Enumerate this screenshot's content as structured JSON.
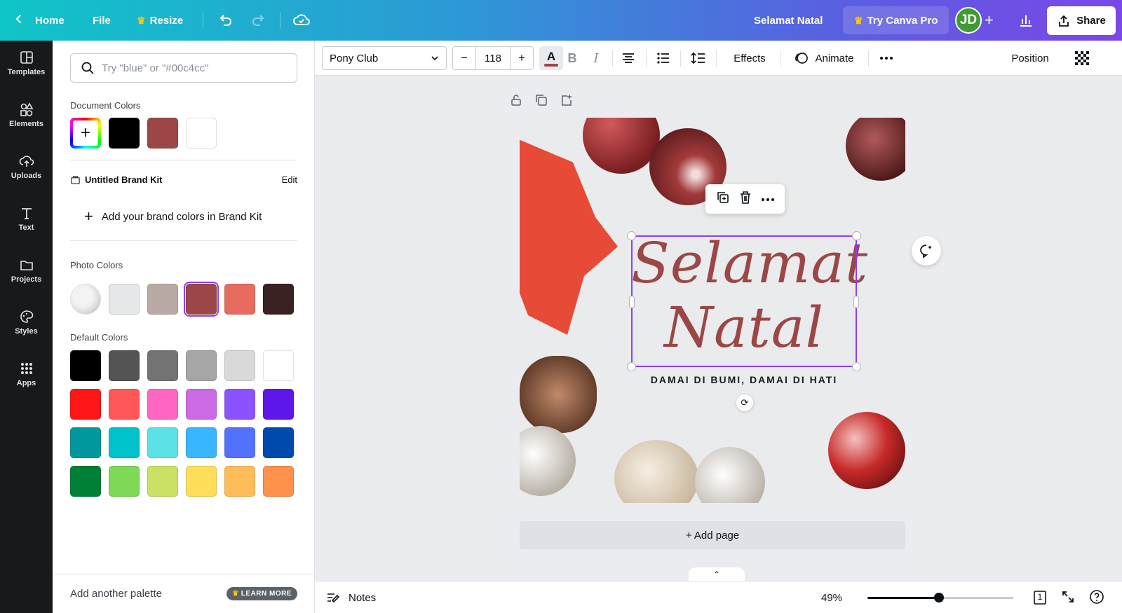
{
  "topbar": {
    "home": "Home",
    "file": "File",
    "resize": "Resize",
    "doc_title": "Selamat Natal",
    "try_pro": "Try Canva Pro",
    "avatar_initials": "JD",
    "share": "Share"
  },
  "rail": {
    "items": [
      {
        "label": "Templates",
        "icon": "templates-icon"
      },
      {
        "label": "Elements",
        "icon": "elements-icon"
      },
      {
        "label": "Uploads",
        "icon": "uploads-icon"
      },
      {
        "label": "Text",
        "icon": "text-icon"
      },
      {
        "label": "Projects",
        "icon": "folder-icon"
      },
      {
        "label": "Styles",
        "icon": "palette-icon"
      },
      {
        "label": "Apps",
        "icon": "apps-icon"
      }
    ]
  },
  "panel": {
    "search_placeholder": "Try \"blue\" or \"#00c4cc\"",
    "document_colors_title": "Document Colors",
    "document_colors": [
      "#000000",
      "#9b4747",
      "#ffffff"
    ],
    "brand_kit_title": "Untitled Brand Kit",
    "brand_kit_edit": "Edit",
    "add_brand_colors": "Add your brand colors in Brand Kit",
    "photo_colors_title": "Photo Colors",
    "photo_colors": [
      "#e4e8e8",
      "#baaaa5",
      "#9b4747",
      "#e86b5f",
      "#3a2222"
    ],
    "selected_color": "#9b4747",
    "default_colors_title": "Default Colors",
    "default_colors": [
      [
        "#000000",
        "#545454",
        "#737373",
        "#a6a6a6",
        "#d9d9d9",
        "#ffffff"
      ],
      [
        "#ff1616",
        "#ff5757",
        "#ff66c4",
        "#cb6ce6",
        "#8c52ff",
        "#5e17eb"
      ],
      [
        "#03989e",
        "#00c2cb",
        "#5ce1e6",
        "#38b6ff",
        "#5271ff",
        "#004aad"
      ],
      [
        "#008037",
        "#7ed957",
        "#c9e265",
        "#ffde59",
        "#ffbd59",
        "#ff914d"
      ]
    ],
    "add_palette": "Add another palette",
    "learn_more": "LEARN MORE"
  },
  "toolbar": {
    "font": "Pony Club",
    "font_size": "118",
    "minus": "−",
    "plus": "+",
    "text_color_letter": "A",
    "text_color": "#9b4747",
    "bold": "B",
    "italic": "I",
    "effects": "Effects",
    "animate": "Animate",
    "position": "Position"
  },
  "canvas": {
    "title_line1": "Selamat",
    "title_line2": "Natal",
    "subtitle": "DAMAI DI BUMI, DAMAI DI HATI",
    "add_page": "+ Add page"
  },
  "bottombar": {
    "notes": "Notes",
    "zoom": "49%",
    "zoom_level": 0.49,
    "page_count": "1"
  }
}
